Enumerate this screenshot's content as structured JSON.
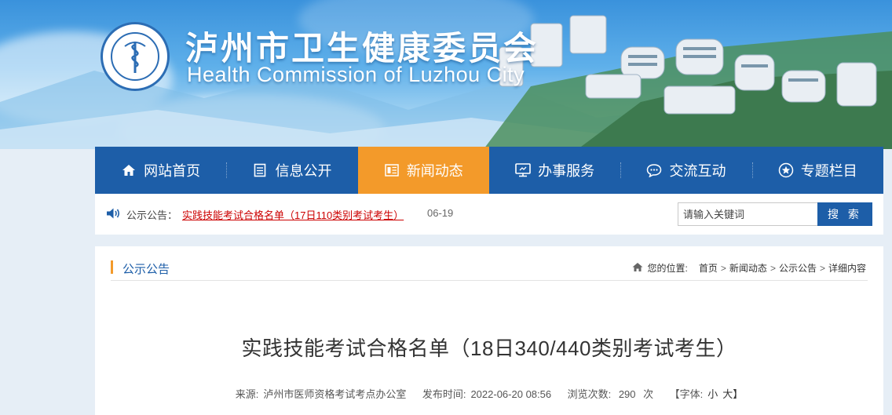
{
  "header": {
    "title": "泸州市卫生健康委员会",
    "subtitle": "Health Commission of Luzhou City",
    "logo_text": "Health Commission of Luzhou City"
  },
  "nav": {
    "items": [
      {
        "label": "网站首页",
        "icon": "home-icon"
      },
      {
        "label": "信息公开",
        "icon": "document-icon"
      },
      {
        "label": "新闻动态",
        "icon": "newspaper-icon",
        "active": true
      },
      {
        "label": "办事服务",
        "icon": "monitor-icon"
      },
      {
        "label": "交流互动",
        "icon": "chat-icon"
      },
      {
        "label": "专题栏目",
        "icon": "star-icon"
      }
    ],
    "active_color": "#f39a2a",
    "bg_color": "#1d5ea8"
  },
  "notice": {
    "label": "公示公告：",
    "link_text": "实践技能考试合格名单（17日110类别考试考生）",
    "date": "06-19"
  },
  "search": {
    "placeholder": "请输入关键词",
    "button": "搜 索"
  },
  "section": {
    "title": "公示公告"
  },
  "breadcrumb": {
    "prefix": "您的位置:",
    "items": [
      "首页",
      "新闻动态",
      "公示公告",
      "详细内容"
    ],
    "separator": ">"
  },
  "article": {
    "title": "实践技能考试合格名单（18日340/440类别考试考生）",
    "source_label": "来源:",
    "source": "泸州市医师资格考试考点办公室",
    "published_label": "发布时间:",
    "published": "2022-06-20 08:56",
    "views_label": "浏览次数:",
    "views": "290",
    "views_unit": "次",
    "font_label": "【字体:",
    "font_small": "小",
    "font_large": "大】"
  }
}
